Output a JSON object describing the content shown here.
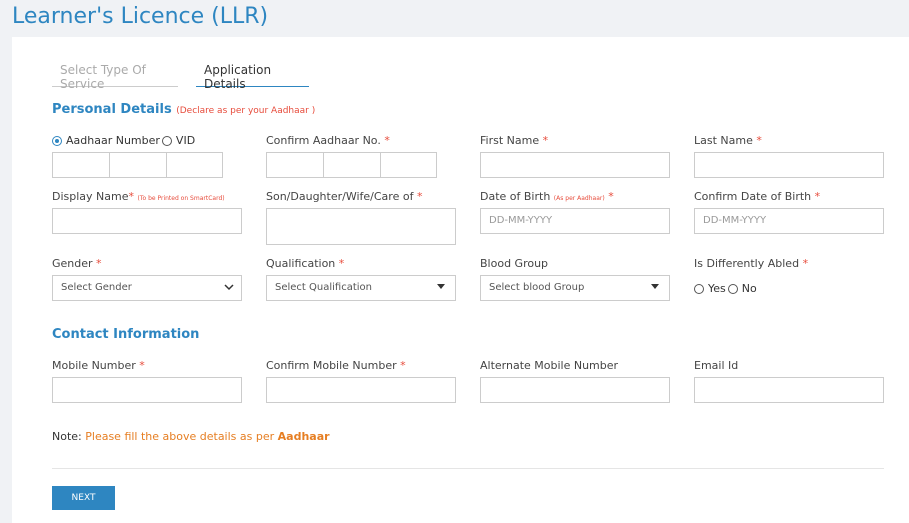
{
  "page_title": "Learner's Licence (LLR)",
  "tabs": [
    {
      "label": "Select Type Of Service",
      "active": false
    },
    {
      "label": "Application Details",
      "active": true
    }
  ],
  "personal_details": {
    "title": "Personal Details",
    "note": "(Declare as per your Aadhaar )",
    "aadhaar_radio_label": "Aadhaar Number",
    "vid_radio_label": "VID",
    "selected_id_type": "Aadhaar Number",
    "confirm_aadhaar_label": "Confirm Aadhaar No.",
    "first_name_label": "First Name",
    "last_name_label": "Last Name",
    "display_name_label": "Display Name",
    "display_name_hint": "(To be Printed on SmartCard)",
    "care_of_label": "Son/Daughter/Wife/Care of",
    "dob_label": "Date of Birth",
    "dob_hint": "(As per Aadhaar)",
    "dob_placeholder": "DD-MM-YYYY",
    "confirm_dob_label": "Confirm Date of Birth",
    "confirm_dob_placeholder": "DD-MM-YYYY",
    "gender_label": "Gender",
    "gender_value": "Select Gender",
    "qualification_label": "Qualification",
    "qualification_value": "Select Qualification",
    "blood_group_label": "Blood Group",
    "blood_group_value": "Select blood Group",
    "differently_abled_label": "Is Differently Abled",
    "yes_label": "Yes",
    "no_label": "No"
  },
  "contact_info": {
    "title": "Contact Information",
    "mobile_label": "Mobile Number",
    "confirm_mobile_label": "Confirm Mobile Number",
    "alt_mobile_label": "Alternate Mobile Number",
    "email_label": "Email Id"
  },
  "note": {
    "prefix": "Note:",
    "text": "Please fill the above details as per",
    "highlight": "Aadhaar"
  },
  "required_mark": "*",
  "next_button": "NEXT",
  "colors": {
    "accent": "#2e86c1",
    "required": "#e74c3c",
    "note": "#e67e22"
  }
}
